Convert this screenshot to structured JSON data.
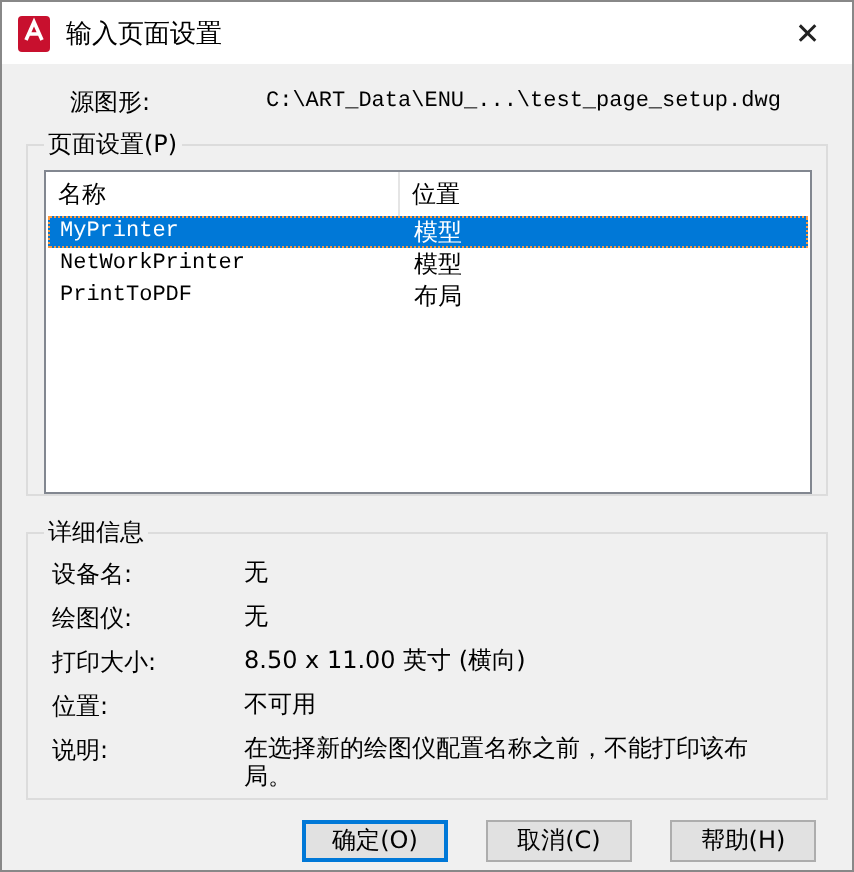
{
  "window": {
    "title": "输入页面设置",
    "close": "✕"
  },
  "source": {
    "label": "源图形:",
    "value": "C:\\ART_Data\\ENU_...\\test_page_setup.dwg"
  },
  "page_setups": {
    "title": "页面设置(P)",
    "columns": [
      "名称",
      "位置"
    ],
    "rows": [
      {
        "name": "MyPrinter",
        "location": "模型",
        "selected": true
      },
      {
        "name": "NetWorkPrinter",
        "location": "模型",
        "selected": false
      },
      {
        "name": "PrintToPDF",
        "location": "布局",
        "selected": false
      }
    ]
  },
  "details": {
    "title": "详细信息",
    "rows": [
      {
        "label": "设备名:",
        "value": "无"
      },
      {
        "label": "绘图仪:",
        "value": "无"
      },
      {
        "label": "打印大小:",
        "value": "8.50 x 11.00 英寸 (横向)"
      },
      {
        "label": "位置:",
        "value": "不可用"
      },
      {
        "label": "说明:",
        "value": "在选择新的绘图仪配置名称之前，不能打印该布局。"
      }
    ]
  },
  "buttons": [
    {
      "label": "确定(O)",
      "default": true
    },
    {
      "label": "取消(C)",
      "default": false
    },
    {
      "label": "帮助(H)",
      "default": false
    }
  ]
}
